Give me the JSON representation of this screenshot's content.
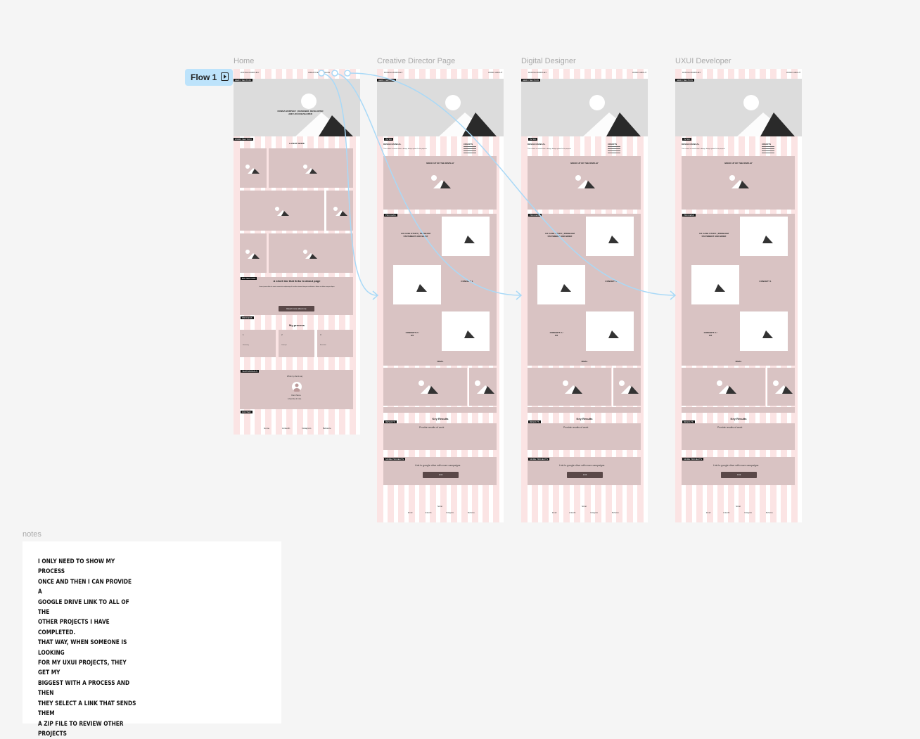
{
  "frames": {
    "home": {
      "title": "Home"
    },
    "creative": {
      "title": "Creative Director Page"
    },
    "digital": {
      "title": "Digital Designer"
    },
    "uxui": {
      "title": "UXUI Developer"
    }
  },
  "flow": {
    "label": "Flow 1",
    "icon": "play-frame-icon"
  },
  "home": {
    "nav_left": "DONNA MURPHEY",
    "nav_right": "CREATIVE HUB BLOG",
    "hero_label": "HERO SECTION",
    "hero_text": "DONNA MURPHEY | DESIGNER, DEVELOPER AND UXUI DEVELOPER",
    "work_label": "WORK SECTION",
    "latest_work": "LATEST WORK",
    "bio_label": "BIO SECTION",
    "bio_heading": "A short bio that links to about page",
    "bio_body": "Lorem ipsum dolor sit amet consectetur adipiscing elit sed do eiusmod tempor incididunt ut labore et dolore magna aliqua.",
    "bio_button": "Read more about me",
    "process_label": "PROCESS",
    "process_heading": "My process",
    "process_steps": [
      "1",
      "2",
      "3"
    ],
    "process_texts": [
      "Discovery",
      "Concept",
      "Execution"
    ],
    "testimonials_label": "TESTIMONIALS",
    "testimonial_heading": "What my clients say",
    "testimonial_name": "Client Name",
    "testimonial_role": "A favorite of mine",
    "footer_label": "FOOTER",
    "footer_links": [
      "Home",
      "LinkedIn",
      "Instagram",
      "Behance"
    ]
  },
  "project": {
    "nav_left": "DONNA MURPHEY",
    "nav_right": "WORK ABOUT",
    "hero_label": "HERO SECTION",
    "intro_label": "INTRO",
    "intro_title": "DESIGN MANUAL",
    "intro_text": "This is about a manual about a design, design system for the projects.",
    "credits_title": "CREDITS",
    "mockup": "MOCK UP OF THE DISPLAY",
    "process_label": "PROCESS",
    "problem": "UX CASE STUDY | PROBLEM STATEMENT AND BRIEF",
    "concept1": "CONCEPT 1",
    "concept2": "CONCEPT 2 / 3/4",
    "final": "FINAL",
    "results_label": "RESULTS",
    "key_results": "Key Results",
    "results_text": "Provide results of work",
    "more_label": "MORE PROJECTS",
    "drive_text": "Link to google drive with more campaigns",
    "link_btn": "Link",
    "footer_title": "Social",
    "footer_links": [
      "Email",
      "LinkedIn",
      "Instagram",
      "Behance"
    ]
  },
  "notes": {
    "title": "notes",
    "text": "I ONLY NEED TO SHOW MY PROCESS\nONCE AND THEN I CAN PROVIDE A\nGOOGLE DRIVE LINK TO ALL OF THE\nOTHER PROJECTS I HAVE COMPLETED.\nTHAT WAY, WHEN SOMEONE IS LOOKING\nFOR MY UXUI PROJECTS, THEY GET MY\nBIGGEST WITH A PROCESS AND THEN\nTHEY SELECT A LINK THAT SENDS THEM\nA ZIP FILE TO REVIEW OTHER PROJECTS"
  },
  "colors": {
    "column": "#fbe4e4",
    "block": "#d9c3c3",
    "hero": "#dcdcdc",
    "flow": "#bde3fb",
    "connector": "#a9d9f7",
    "button": "#5a4848"
  }
}
